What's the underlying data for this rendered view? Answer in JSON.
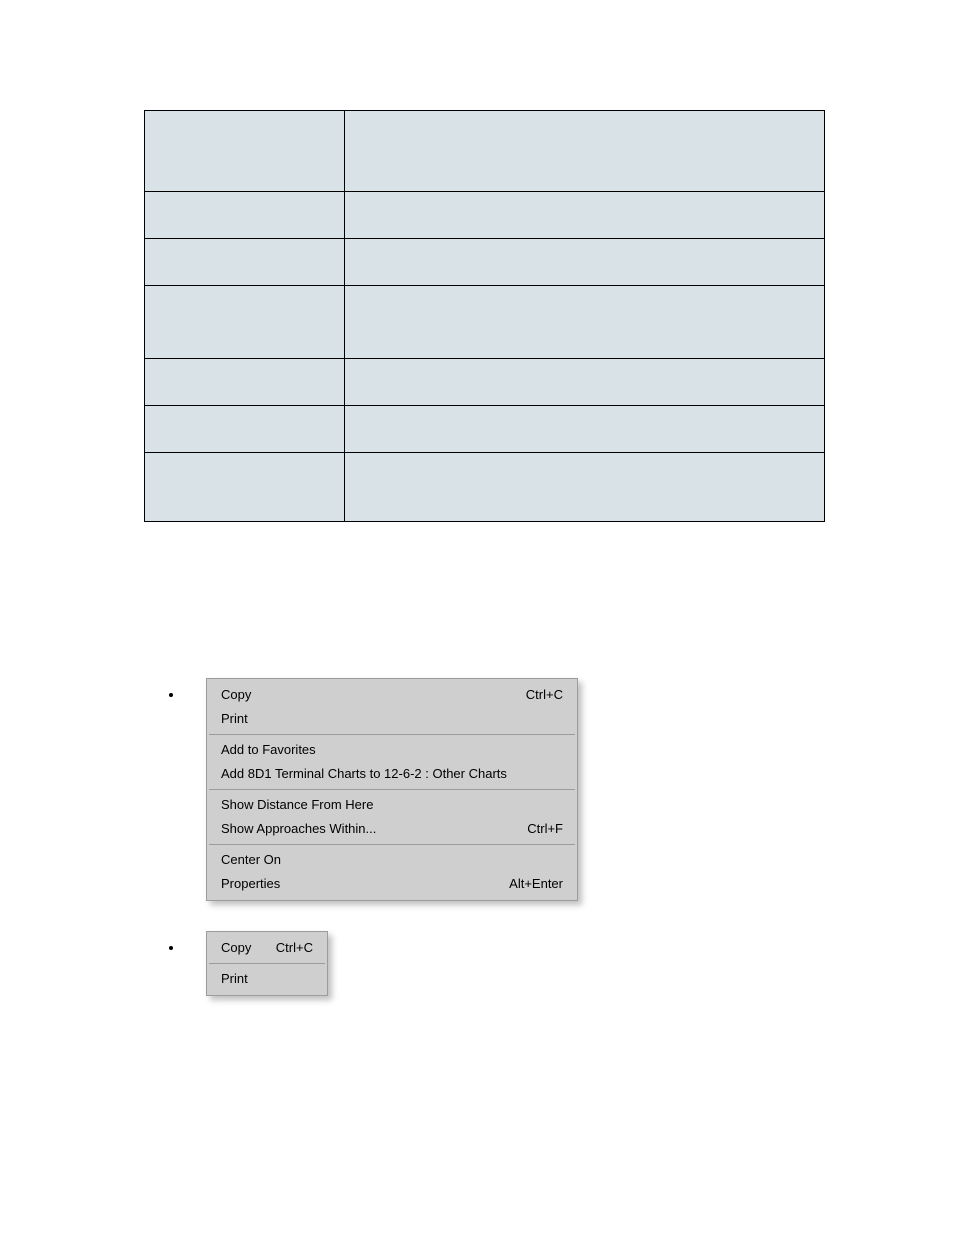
{
  "table": {
    "rows": [
      {
        "left": "",
        "right": "",
        "height": "row-tall"
      },
      {
        "left": "",
        "right": "",
        "height": "row-med"
      },
      {
        "left": "",
        "right": "",
        "height": "row-med"
      },
      {
        "left": "",
        "right": "",
        "height": "row-bigger"
      },
      {
        "left": "",
        "right": "",
        "height": "row-med"
      },
      {
        "left": "",
        "right": "",
        "height": "row-med"
      },
      {
        "left": "",
        "right": "",
        "height": "row-tall2"
      }
    ]
  },
  "contextMenuLarge": {
    "groups": [
      [
        {
          "label": "Copy",
          "shortcut": "Ctrl+C"
        },
        {
          "label": "Print",
          "shortcut": ""
        }
      ],
      [
        {
          "label": "Add to Favorites",
          "shortcut": ""
        },
        {
          "label": "Add 8D1 Terminal Charts to 12-6-2 : Other Charts",
          "shortcut": ""
        }
      ],
      [
        {
          "label": "Show Distance From Here",
          "shortcut": ""
        },
        {
          "label": "Show Approaches Within...",
          "shortcut": "Ctrl+F"
        }
      ],
      [
        {
          "label": "Center On",
          "shortcut": ""
        },
        {
          "label": "Properties",
          "shortcut": "Alt+Enter"
        }
      ]
    ]
  },
  "contextMenuSmall": {
    "groups": [
      [
        {
          "label": "Copy",
          "shortcut": "Ctrl+C"
        }
      ],
      [
        {
          "label": "Print",
          "shortcut": ""
        }
      ]
    ]
  }
}
